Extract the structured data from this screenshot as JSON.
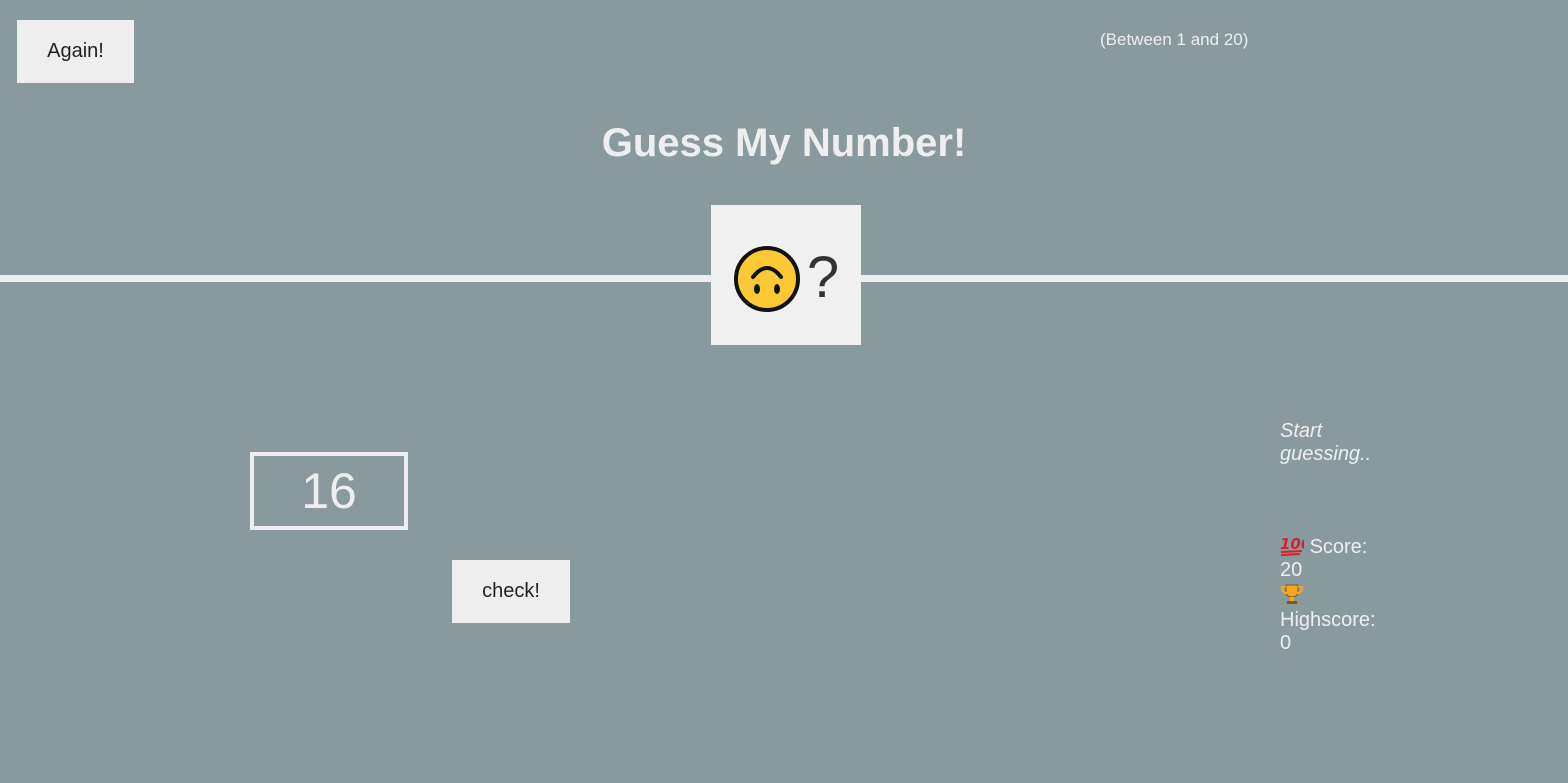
{
  "header": {
    "again_label": "Again!",
    "range_hint": "(Between 1 and 20)",
    "title": "Guess My Number!"
  },
  "secret": {
    "icon": "upside-down-face-icon",
    "question_mark": "?"
  },
  "guess": {
    "value": "16",
    "check_label": "check!"
  },
  "status": {
    "message": "Start guessing..",
    "score_icon": "hundred-points-icon",
    "score_label": "Score:",
    "score_value": "20",
    "highscore_icon": "trophy-icon",
    "highscore_label": "Highscore:",
    "highscore_value": "0"
  },
  "colors": {
    "background": "#889a9e",
    "panel": "#eeeeee",
    "text": "#eeeeee",
    "emoji_yellow": "#fcc934"
  }
}
